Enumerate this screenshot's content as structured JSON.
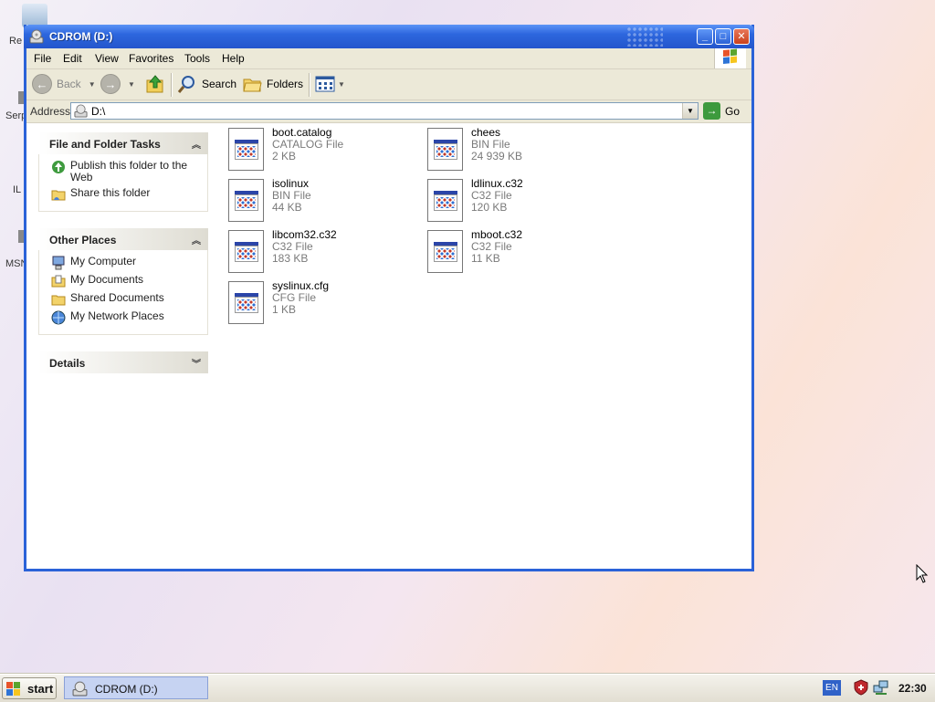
{
  "desktop": {
    "labels": [
      "Re",
      "Serp",
      "IL",
      "MSN"
    ]
  },
  "window": {
    "title": "CDROM (D:)",
    "menu": [
      "File",
      "Edit",
      "View",
      "Favorites",
      "Tools",
      "Help"
    ],
    "toolbar": {
      "back": "Back",
      "search": "Search",
      "folders": "Folders"
    },
    "address": {
      "label": "Address",
      "value": "D:\\",
      "go": "Go"
    }
  },
  "tasks": {
    "file_folder_title": "File and Folder Tasks",
    "file_folder_items": [
      "Publish this folder to the Web",
      "Share this folder"
    ],
    "other_places_title": "Other Places",
    "other_places_items": [
      "My Computer",
      "My Documents",
      "Shared Documents",
      "My Network Places"
    ],
    "details_title": "Details"
  },
  "files": [
    {
      "name": "boot.catalog",
      "type": "CATALOG File",
      "size": "2 KB"
    },
    {
      "name": "chees",
      "type": "BIN File",
      "size": "24 939 KB"
    },
    {
      "name": "isolinux",
      "type": "BIN File",
      "size": "44 KB"
    },
    {
      "name": "ldlinux.c32",
      "type": "C32 File",
      "size": "120 KB"
    },
    {
      "name": "libcom32.c32",
      "type": "C32 File",
      "size": "183 KB"
    },
    {
      "name": "mboot.c32",
      "type": "C32 File",
      "size": "11 KB"
    },
    {
      "name": "syslinux.cfg",
      "type": "CFG File",
      "size": "1 KB"
    }
  ],
  "taskbar": {
    "start": "start",
    "task_button": "CDROM (D:)",
    "lang": "EN",
    "clock": "22:30"
  },
  "colors": {
    "titlebar": "#2456cc",
    "window_border": "#2a62d8",
    "chrome": "#ece9d8"
  }
}
